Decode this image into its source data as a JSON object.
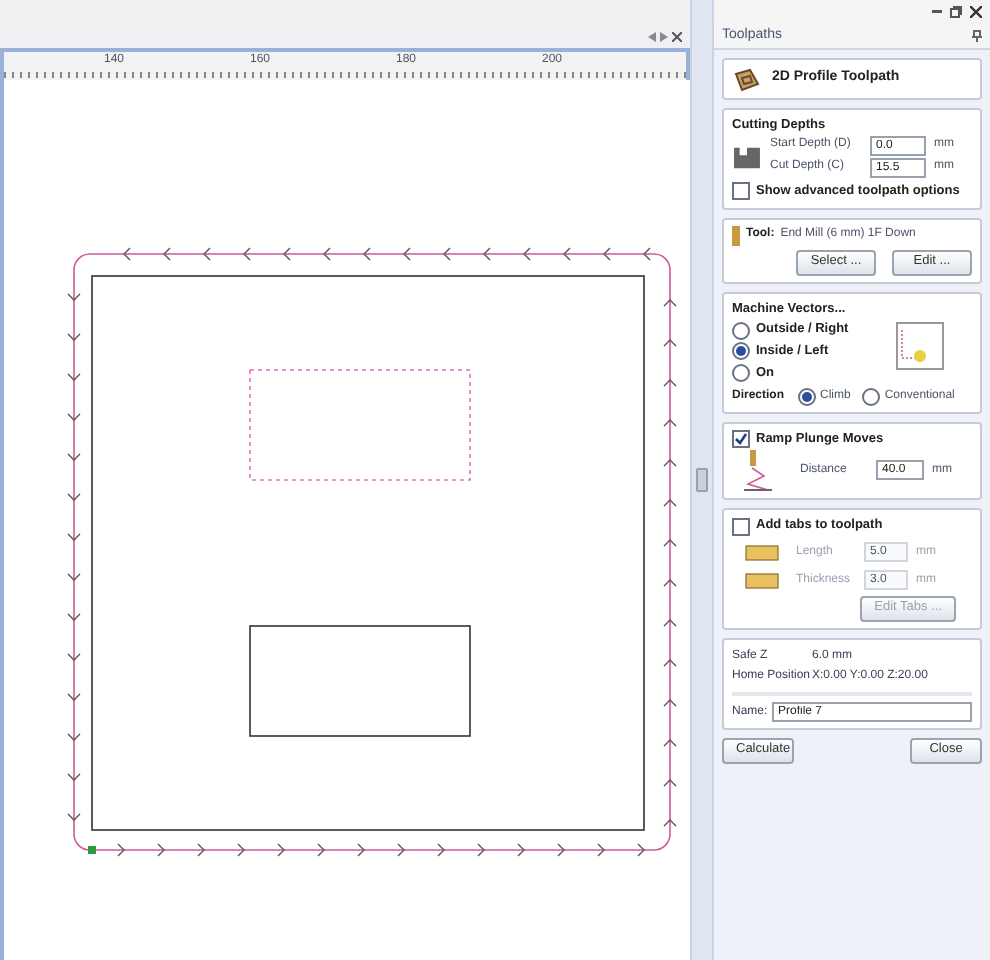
{
  "ruler": {
    "labels": [
      "140",
      "160",
      "180",
      "200"
    ]
  },
  "panel": {
    "title": "Toolpaths",
    "header": "2D Profile Toolpath",
    "cutting_depths": {
      "title": "Cutting Depths",
      "fields": [
        {
          "label": "Start Depth (D)",
          "value": "0.0",
          "unit": "mm"
        },
        {
          "label": "Cut Depth (C)",
          "value": "15.5",
          "unit": "mm"
        }
      ]
    },
    "advanced": {
      "label": "Show advanced toolpath options",
      "checked": false
    },
    "tool": {
      "label": "Tool:",
      "value": "End Mill (6 mm) 1F Down",
      "buttons": [
        "Select ...",
        "Edit ..."
      ]
    },
    "machine_vectors": {
      "title": "Machine Vectors...",
      "options": [
        {
          "label": "Outside / Right",
          "selected": false
        },
        {
          "label": "Inside / Left",
          "selected": true
        },
        {
          "label": "On",
          "selected": false
        }
      ],
      "direction": {
        "label": "Direction",
        "options": [
          {
            "label": "Climb",
            "selected": true
          },
          {
            "label": "Conventional",
            "selected": false
          }
        ]
      }
    },
    "ramp": {
      "label": "Ramp Plunge Moves",
      "checked": true,
      "distance": {
        "label": "Distance",
        "value": "40.0",
        "unit": "mm"
      }
    },
    "tabs": {
      "label": "Add tabs to toolpath",
      "checked": false,
      "fields": [
        {
          "label": "Length",
          "value": "5.0",
          "unit": "mm"
        },
        {
          "label": "Thickness",
          "value": "3.0",
          "unit": "mm"
        }
      ],
      "button": "Edit Tabs ..."
    },
    "info": [
      {
        "label": "Safe Z",
        "value": "6.0 mm"
      },
      {
        "label": "Home Position",
        "value": "X:0.00 Y:0.00 Z:20.00"
      }
    ],
    "name": {
      "label": "Name:",
      "value": "Profile 7"
    },
    "buttons": [
      "Calculate",
      "Close"
    ]
  }
}
